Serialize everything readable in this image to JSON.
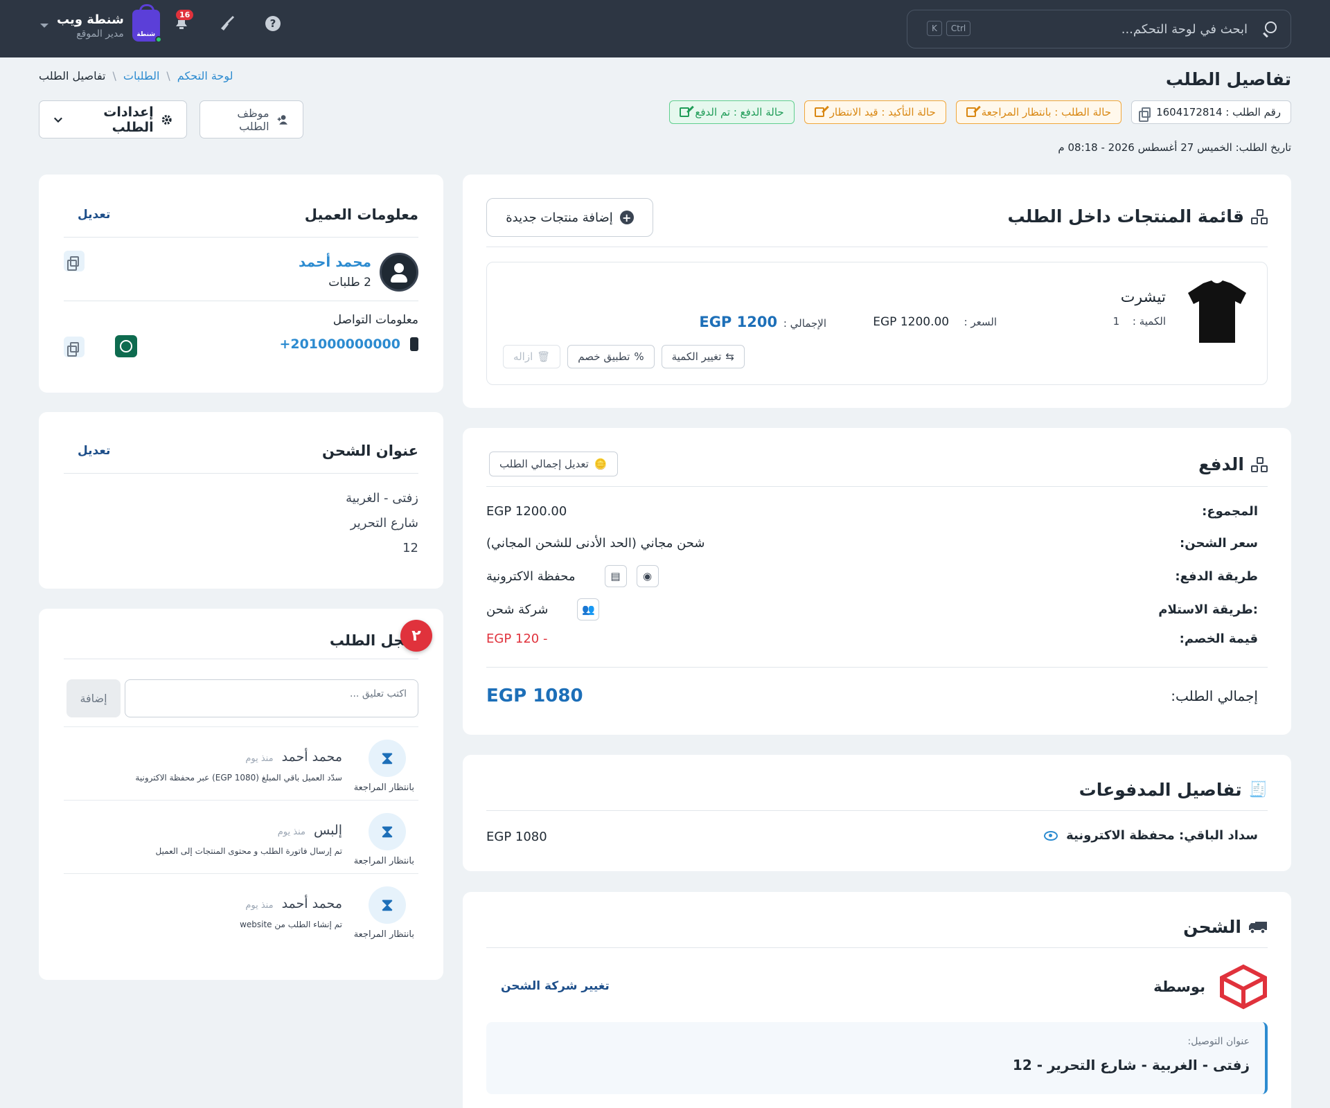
{
  "topbar": {
    "search_placeholder": "ابحث في لوحة التحكم...",
    "kbd_ctrl": "Ctrl",
    "kbd_k": "K",
    "notifications_count": "16",
    "help_glyph": "?",
    "user_name": "شنطة ويب",
    "user_role": "مدير الموقع",
    "logo_text": "شنطة"
  },
  "page": {
    "title": "تفاصيل الطلب",
    "breadcrumb": [
      "لوحة التحكم",
      "الطلبات",
      "تفاصيل الطلب"
    ],
    "order_number": "رقم الطلب :  1604172814",
    "order_status": "حالة الطلب :  بانتظار المراجعة",
    "confirm_status": "حالة التأكيد :  قيد الانتظار",
    "payment_status": "حالة الدفع :  تم الدفع",
    "order_date": "تاريخ الطلب: الخميس 27 أغسطس 2026 - 08:18 م",
    "settings_button": "إعدادات الطلب",
    "staff_button": "موظف الطلب"
  },
  "products": {
    "title": "قائمة المنتجات داخل الطلب",
    "add_button": "إضافة منتجات جديدة",
    "items": [
      {
        "name": "تيشرت",
        "qty_label": "الكمية :",
        "qty": "1",
        "price_label": "السعر :",
        "price": "EGP 1200.00",
        "total_label": "الإجمالي :",
        "total": "EGP 1200",
        "change_qty": "تغيير الكمية",
        "apply_discount": "تطبيق خصم",
        "remove": "ازاله"
      }
    ]
  },
  "payment": {
    "title": "الدفع",
    "edit_total_button": "تعديل إجمالي الطلب",
    "subtotal_label": "المجموع:",
    "subtotal": "EGP 1200.00",
    "shipping_label": "سعر الشحن:",
    "shipping": "شحن مجاني (الحد الأدنى للشحن المجاني)",
    "method_label": "طريقة الدفع:",
    "method": "محفظة الاكترونية",
    "receive_label": ":طريقة الاستلام",
    "receive": "شركة شحن",
    "discount_label": "قيمة الخصم:",
    "discount": "EGP 120 -",
    "total_label": "إجمالي الطلب:",
    "total": "EGP 1080"
  },
  "paid": {
    "title": "تفاصيل المدفوعات",
    "label": "سداد الباقي: محفظة الاكترونية",
    "amount": "EGP 1080"
  },
  "shipping": {
    "title": "الشحن",
    "courier": "بوسطة",
    "change_button": "تغيير شركة الشحن",
    "address_label": "عنوان التوصيل:",
    "address": "زفتى - الغربية - شارع التحرير - 12"
  },
  "customer": {
    "title": "معلومات العميل",
    "edit": "تعديل",
    "name": "محمد أحمد",
    "orders": "2 طلبات",
    "contact_label": "معلومات التواصل",
    "phone": "+201000000000"
  },
  "address": {
    "title": "عنوان الشحن",
    "edit": "تعديل",
    "lines": [
      "زفتى - الغربية",
      "شارع التحرير",
      "12"
    ]
  },
  "log": {
    "title": "سجل الطلب",
    "step": "٢",
    "comment_placeholder": "اكتب تعليق ...",
    "add_button": "إضافة",
    "items": [
      {
        "who": "محمد أحمد",
        "time": "منذ يوم",
        "desc": "سدّد العميل باقي المبلغ (EGP 1080) عبر محفظة الاكترونية",
        "status": "بانتظار المراجعة"
      },
      {
        "who": "إلبس",
        "time": "منذ يوم",
        "desc": "تم إرسال فاتورة الطلب و محتوى المنتجات إلى العميل",
        "status": "بانتظار المراجعة"
      },
      {
        "who": "محمد أحمد",
        "time": "منذ يوم",
        "desc": "تم إنشاء الطلب من website",
        "status": "بانتظار المراجعة"
      }
    ]
  },
  "colors": {
    "topbar": "#2d3643",
    "accent_blue": "#2c8bd0",
    "orange_status": "#d98712",
    "green_status": "#1f9c57",
    "danger": "#e0323c"
  }
}
